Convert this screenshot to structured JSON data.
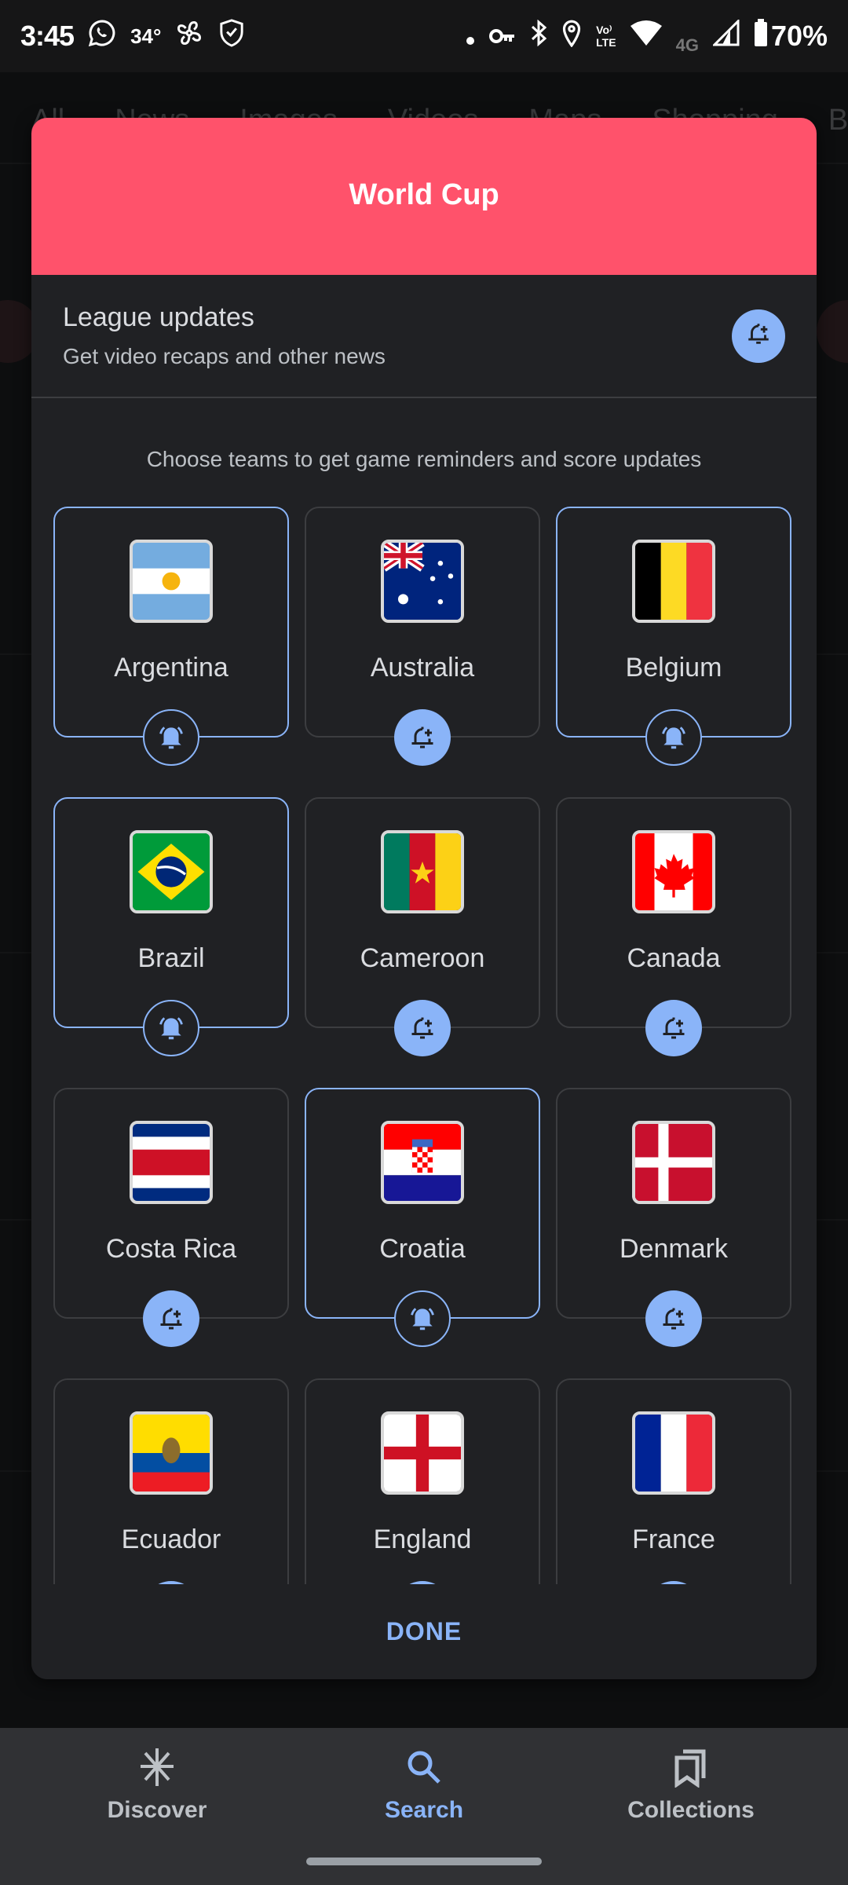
{
  "status_bar": {
    "time": "3:45",
    "temperature": "34°",
    "network_label": "Vo LTE",
    "network_type": "4G",
    "battery": "70%",
    "icons": [
      "whatsapp-icon",
      "fan-icon",
      "shield-check-icon",
      "dot-icon",
      "vpn-key-icon",
      "bluetooth-icon",
      "location-icon",
      "volte-icon",
      "wifi-icon",
      "signal-icon",
      "battery-icon"
    ]
  },
  "background": {
    "tabs": [
      "All",
      "News",
      "Images",
      "Videos",
      "Maps",
      "Shopping",
      "Books"
    ]
  },
  "dialog": {
    "title": "World Cup",
    "header_color": "#ff526b",
    "league": {
      "title": "League updates",
      "subtitle": "Get video recaps and other news",
      "button_icon": "bell-plus-icon",
      "subscribed": false
    },
    "prompt": "Choose teams to get game reminders and score updates",
    "teams": [
      {
        "name": "Argentina",
        "flag": "argentina",
        "subscribed": true
      },
      {
        "name": "Australia",
        "flag": "australia",
        "subscribed": false
      },
      {
        "name": "Belgium",
        "flag": "belgium",
        "subscribed": true
      },
      {
        "name": "Brazil",
        "flag": "brazil",
        "subscribed": true
      },
      {
        "name": "Cameroon",
        "flag": "cameroon",
        "subscribed": false
      },
      {
        "name": "Canada",
        "flag": "canada",
        "subscribed": false
      },
      {
        "name": "Costa Rica",
        "flag": "costa-rica",
        "subscribed": false
      },
      {
        "name": "Croatia",
        "flag": "croatia",
        "subscribed": true
      },
      {
        "name": "Denmark",
        "flag": "denmark",
        "subscribed": false
      },
      {
        "name": "Ecuador",
        "flag": "ecuador",
        "subscribed": false
      },
      {
        "name": "England",
        "flag": "england",
        "subscribed": false
      },
      {
        "name": "France",
        "flag": "france",
        "subscribed": false
      }
    ],
    "done_label": "DONE",
    "accent_color": "#8ab4f8"
  },
  "bottom_nav": {
    "items": [
      {
        "label": "Discover",
        "icon": "discover-icon",
        "active": false
      },
      {
        "label": "Search",
        "icon": "search-icon",
        "active": true
      },
      {
        "label": "Collections",
        "icon": "collections-icon",
        "active": false
      }
    ]
  }
}
